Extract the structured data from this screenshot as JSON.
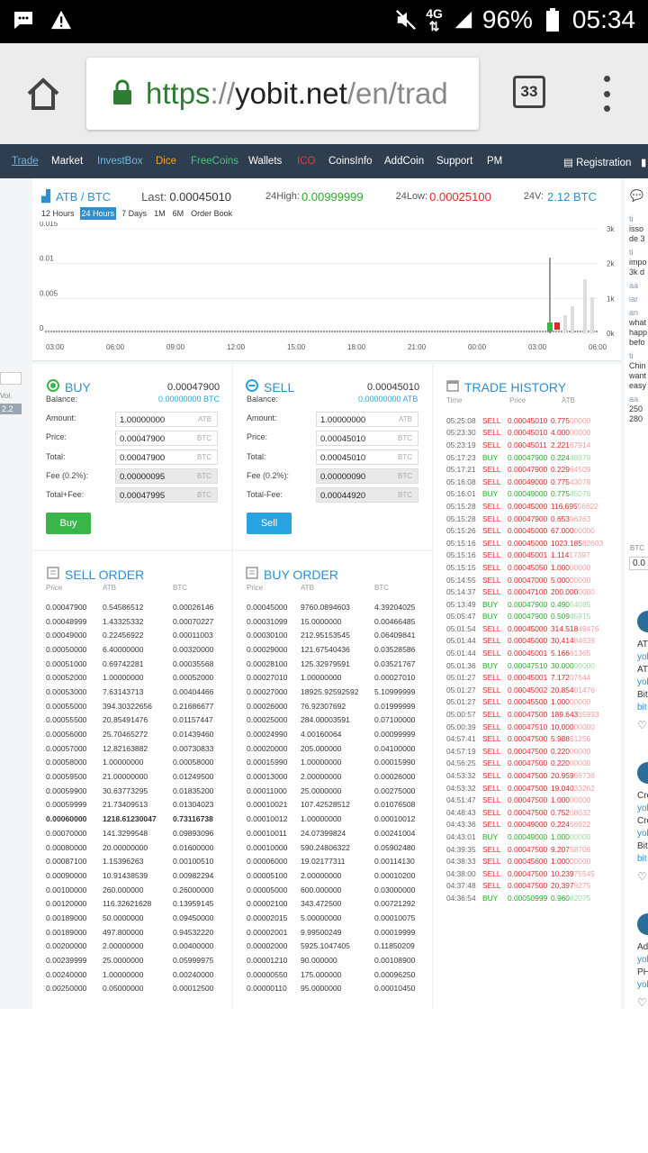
{
  "status_bar": {
    "network": "4G",
    "battery": "96%",
    "time": "05:34"
  },
  "browser": {
    "url_protocol": "https",
    "url_sep": "://",
    "url_host": "yobit.net",
    "url_path": "/en/trad",
    "tab_count": "33"
  },
  "nav": {
    "trade": "Trade",
    "market": "Market",
    "investbox": "InvestBox",
    "dice": "Dice",
    "freecoins": "FreeCoins",
    "wallets": "Wallets",
    "ico": "ICO",
    "coinsinfo": "CoinsInfo",
    "addcoin": "AddCoin",
    "support": "Support",
    "pm": "PM",
    "registration": "Registration"
  },
  "ticker": {
    "pair": "ATB / BTC",
    "last_label": "Last:",
    "last": "0.00045010",
    "high_label": "24High:",
    "high": "0.00999999",
    "low_label": "24Low:",
    "low": "0.00025100",
    "vol_label": "24V:",
    "vol": "2.12 BTC"
  },
  "timeframes": [
    "12 Hours",
    "24 Hours",
    "7 Days",
    "1M",
    "6M",
    "Order Book"
  ],
  "chart_data": {
    "type": "candlestick",
    "y_ticks": [
      "0.015",
      "0.01",
      "0.005",
      "0"
    ],
    "y2_ticks": [
      "3k",
      "2k",
      "1k",
      "0k"
    ],
    "x_ticks": [
      "03:00",
      "06:00",
      "09:00",
      "12:00",
      "15:00",
      "18:00",
      "21:00",
      "00:00",
      "03:00",
      "06:00"
    ],
    "ylim": [
      0,
      0.015
    ]
  },
  "left_stub": {
    "vol": "Vol.",
    "val": "2.2"
  },
  "buy": {
    "title": "BUY",
    "price": "0.00047900",
    "balance_label": "Balance:",
    "balance": "0.00000000 BTC",
    "amount_label": "Amount:",
    "amount": "1.00000000",
    "amount_unit": "ATB",
    "price_label": "Price:",
    "price_val": "0.00047900",
    "price_unit": "BTC",
    "total_label": "Total:",
    "total": "0.00047900",
    "total_unit": "BTC",
    "fee_label": "Fee (0.2%):",
    "fee": "0.00000095",
    "fee_unit": "BTC",
    "tf_label": "Total+Fee:",
    "tf": "0.00047995",
    "tf_unit": "BTC",
    "button": "Buy"
  },
  "sell": {
    "title": "SELL",
    "price": "0.00045010",
    "balance_label": "Balance:",
    "balance": "0.00000000 ATB",
    "amount_label": "Amount:",
    "amount": "1.00000000",
    "amount_unit": "ATB",
    "price_label": "Price:",
    "price_val": "0.00045010",
    "price_unit": "BTC",
    "total_label": "Total:",
    "total": "0.00045010",
    "total_unit": "BTC",
    "fee_label": "Fee (0.2%):",
    "fee": "0.00000090",
    "fee_unit": "BTC",
    "tf_label": "Total-Fee:",
    "tf": "0.00044920",
    "tf_unit": "BTC",
    "button": "Sell"
  },
  "history": {
    "title": "TRADE HISTORY",
    "headers": [
      "Time",
      "Price",
      "ATB"
    ],
    "rows": [
      [
        "05:25:08",
        "SELL",
        "0.00045010",
        "0.775",
        "00000"
      ],
      [
        "05:23:30",
        "SELL",
        "0.00045010",
        "4.000",
        "00000"
      ],
      [
        "05:23:19",
        "SELL",
        "0.00045011",
        "2.221",
        "67914"
      ],
      [
        "05:17:23",
        "BUY",
        "0.00047900",
        "0.224",
        "48979"
      ],
      [
        "05:17:21",
        "SELL",
        "0.00047900",
        "0.229",
        "64509"
      ],
      [
        "05:16:08",
        "SELL",
        "0.00049000",
        "0.775",
        "43078"
      ],
      [
        "05:16:01",
        "BUY",
        "0.00049000",
        "0.775",
        "45078"
      ],
      [
        "05:15:28",
        "SELL",
        "0.00045000",
        "116.695",
        "56622"
      ],
      [
        "05:15:28",
        "SELL",
        "0.00047900",
        "0.653",
        "96263"
      ],
      [
        "05:15:26",
        "SELL",
        "0.00045000",
        "67.000",
        "00000"
      ],
      [
        "05:15:16",
        "SELL",
        "0.00045000",
        "1023.185",
        "82603"
      ],
      [
        "05:15:16",
        "SELL",
        "0.00045001",
        "1.114",
        "17397"
      ],
      [
        "05:15:15",
        "SELL",
        "0.00045050",
        "1.000",
        "00000"
      ],
      [
        "05:14:55",
        "SELL",
        "0.00047000",
        "5.000",
        "00000"
      ],
      [
        "05:14:37",
        "SELL",
        "0.00047100",
        "200.000",
        "0000"
      ],
      [
        "05:13:49",
        "BUY",
        "0.00047900",
        "0.490",
        "54085"
      ],
      [
        "05:05:47",
        "BUY",
        "0.00047900",
        "0.509",
        "45915"
      ],
      [
        "05:01:54",
        "SELL",
        "0.00045000",
        "314.518",
        "49476"
      ],
      [
        "05:01:44",
        "SELL",
        "0.00045000",
        "30.414",
        "84639"
      ],
      [
        "05:01:44",
        "SELL",
        "0.00045001",
        "5.166",
        "61365"
      ],
      [
        "05:01:36",
        "BUY",
        "0.00047510",
        "30.000",
        "00000"
      ],
      [
        "05:01:27",
        "SELL",
        "0.00045001",
        "7.172",
        "07644"
      ],
      [
        "05:01:27",
        "SELL",
        "0.00045002",
        "20.854",
        "91476"
      ],
      [
        "05:01:27",
        "SELL",
        "0.00045500",
        "1.000",
        "00000"
      ],
      [
        "05:00:57",
        "SELL",
        "0.00047500",
        "189.643",
        "35993"
      ],
      [
        "05:00:39",
        "SELL",
        "0.00047510",
        "10.000",
        "00000"
      ],
      [
        "04:57:41",
        "SELL",
        "0.00047500",
        "5.988",
        "61256"
      ],
      [
        "04:57:19",
        "SELL",
        "0.00047500",
        "0.220",
        "00000"
      ],
      [
        "04:56:25",
        "SELL",
        "0.00047500",
        "0.220",
        "00000"
      ],
      [
        "04:53:32",
        "SELL",
        "0.00047500",
        "20.959",
        "66738"
      ],
      [
        "04:53:32",
        "SELL",
        "0.00047500",
        "19.040",
        "33262"
      ],
      [
        "04:51:47",
        "SELL",
        "0.00047500",
        "1.000",
        "00000"
      ],
      [
        "04:48:43",
        "SELL",
        "0.00047500",
        "0.752",
        "08032"
      ],
      [
        "04:43:36",
        "SELL",
        "0.00049000",
        "0.224",
        "56922"
      ],
      [
        "04:43:01",
        "BUY",
        "0.00049000",
        "1.000",
        "00000"
      ],
      [
        "04:39:35",
        "SELL",
        "0.00047500",
        "9.207",
        "58706"
      ],
      [
        "04:38:33",
        "SELL",
        "0.00045600",
        "1.000",
        "00000"
      ],
      [
        "04:38:00",
        "SELL",
        "0.00047500",
        "10.239",
        "75545"
      ],
      [
        "04:37:48",
        "SELL",
        "0.00047500",
        "20.397",
        "9275"
      ],
      [
        "04:36:54",
        "BUY",
        "0.00050999",
        "0.960",
        "82075"
      ]
    ]
  },
  "sell_orders": {
    "title": "SELL ORDER",
    "headers": [
      "Price",
      "ATB",
      "BTC"
    ],
    "rows": [
      [
        "0.00047900",
        "0.54586512",
        "0.00026146"
      ],
      [
        "0.00048999",
        "1.43325332",
        "0.00070227"
      ],
      [
        "0.00049000",
        "0.22456922",
        "0.00011003"
      ],
      [
        "0.00050000",
        "6.40000000",
        "0.00320000"
      ],
      [
        "0.00051000",
        "0.69742281",
        "0.00035568"
      ],
      [
        "0.00052000",
        "1.00000000",
        "0.00052000"
      ],
      [
        "0.00053000",
        "7.63143713",
        "0.00404466"
      ],
      [
        "0.00055000",
        "394.30322656",
        "0.21686677"
      ],
      [
        "0.00055500",
        "20.85491476",
        "0.01157447"
      ],
      [
        "0.00056000",
        "25.70465272",
        "0.01439460"
      ],
      [
        "0.00057000",
        "12.82163882",
        "0.00730833"
      ],
      [
        "0.00058000",
        "1.00000000",
        "0.00058000"
      ],
      [
        "0.00059500",
        "21.00000000",
        "0.01249500"
      ],
      [
        "0.00059900",
        "30.63773295",
        "0.01835200"
      ],
      [
        "0.00059999",
        "21.73409513",
        "0.01304023"
      ],
      [
        "0.00060000",
        "1218.61230047",
        "0.73116738"
      ],
      [
        "0.00070000",
        "141.3299548",
        "0.09893096"
      ],
      [
        "0.00080000",
        "20.00000000",
        "0.01600000"
      ],
      [
        "0.00087100",
        "1.15396263",
        "0.00100510"
      ],
      [
        "0.00090000",
        "10.91438539",
        "0.00982294"
      ],
      [
        "0.00100000",
        "260.000000",
        "0.26000000"
      ],
      [
        "0.00120000",
        "116.32621628",
        "0.13959145"
      ],
      [
        "0.00189000",
        "50.0000000",
        "0.09450000"
      ],
      [
        "0.00189000",
        "497.800000",
        "0.94532220"
      ],
      [
        "0.00200000",
        "2.00000000",
        "0.00400000"
      ],
      [
        "0.00239999",
        "25.0000000",
        "0.05999975"
      ],
      [
        "0.00240000",
        "1.00000000",
        "0.00240000"
      ],
      [
        "0.00250000",
        "0.05000000",
        "0.00012500"
      ]
    ]
  },
  "buy_orders": {
    "title": "BUY ORDER",
    "headers": [
      "Price",
      "ATB",
      "BTC"
    ],
    "rows": [
      [
        "0.00045000",
        "9760.0894603",
        "4.39204025"
      ],
      [
        "0.00031099",
        "15.0000000",
        "0.00466485"
      ],
      [
        "0.00030100",
        "212.95153545",
        "0.06409841"
      ],
      [
        "0.00029000",
        "121.67540436",
        "0.03528586"
      ],
      [
        "0.00028100",
        "125.32979591",
        "0.03521767"
      ],
      [
        "0.00027010",
        "1.00000000",
        "0.00027010"
      ],
      [
        "0.00027000",
        "18925.92592592",
        "5.10999999"
      ],
      [
        "0.00026000",
        "76.92307692",
        "0.01999999"
      ],
      [
        "0.00025000",
        "284.00003591",
        "0.07100000"
      ],
      [
        "0.00024990",
        "4.00160064",
        "0.00099999"
      ],
      [
        "0.00020000",
        "205.000000",
        "0.04100000"
      ],
      [
        "0.00015990",
        "1.00000000",
        "0.00015990"
      ],
      [
        "0.00013000",
        "2.00000000",
        "0.00026000"
      ],
      [
        "0.00011000",
        "25.0000000",
        "0.00275000"
      ],
      [
        "0.00010021",
        "107.42528512",
        "0.01076508"
      ],
      [
        "0.00010012",
        "1.00000000",
        "0.00010012"
      ],
      [
        "0.00010011",
        "24.07399824",
        "0.00241004"
      ],
      [
        "0.00010000",
        "590.24806322",
        "0.05902480"
      ],
      [
        "0.00006000",
        "19.02177311",
        "0.00114130"
      ],
      [
        "0.00005100",
        "2.00000000",
        "0.00010200"
      ],
      [
        "0.00005000",
        "600.000000",
        "0.03000000"
      ],
      [
        "0.00002100",
        "343.472500",
        "0.00721292"
      ],
      [
        "0.00002015",
        "5.00000000",
        "0.00010075"
      ],
      [
        "0.00002001",
        "9.99500249",
        "0.00019999"
      ],
      [
        "0.00002000",
        "5925.1047405",
        "0.11850209"
      ],
      [
        "0.00001210",
        "90.000000",
        "0.00108900"
      ],
      [
        "0.00000550",
        "175.000000",
        "0.00096250"
      ],
      [
        "0.00000110",
        "95.0000000",
        "0.00010450"
      ]
    ]
  },
  "right_sidebar": {
    "chat": [
      [
        "ti",
        "isso",
        "de 3"
      ],
      [
        "ti",
        "impo",
        "3k d"
      ],
      [
        "aa"
      ],
      [
        "iar"
      ],
      [
        "an",
        "what",
        "happ",
        "befo"
      ],
      [
        "ti",
        "Chin",
        "want",
        "easy"
      ],
      [
        "aa",
        "250",
        "280"
      ]
    ],
    "btc_label": "BTC",
    "btc_val": "0.0",
    "news": [
      [
        "ATI",
        "yob",
        "ATI",
        "yob",
        "Bit",
        "bit"
      ],
      [
        "Cro",
        "yob",
        "Cro",
        "yob",
        "Bit",
        "bit"
      ],
      [
        "Add",
        "yob",
        "PH",
        "yob"
      ]
    ]
  }
}
